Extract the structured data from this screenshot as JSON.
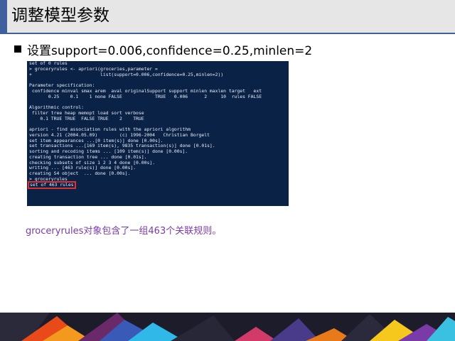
{
  "slide": {
    "title": "调整模型参数",
    "bullet": "设置support=0.006,confidence=0.25,minlen=2",
    "caption": "groceryrules对象包含了一组463个关联规则。"
  },
  "console": {
    "lines": [
      "set of 0 rules",
      "> groceryrules <- apriori(groceries,parameter =",
      "+                         list(support=0.006,confidence=0.25,minlen=2))",
      "",
      "Parameter specification:",
      " confidence minval smax arem  aval originalSupport support minlen maxlen target   ext",
      "       0.25    0.1    1 none FALSE            TRUE   0.006      2     10  rules FALSE",
      "",
      "Algorithmic control:",
      " filter tree heap memopt load sort verbose",
      "    0.1 TRUE TRUE  FALSE TRUE    2    TRUE",
      "",
      "apriori - find association rules with the apriori algorithm",
      "version 4.21 (2004.05.09)        (c) 1996-2004   Christian Borgelt",
      "set item appearances ...[0 item(s)] done [0.00s].",
      "set transactions ...[169 item(s), 9835 transaction(s)] done [0.01s].",
      "sorting and recoding items ... [109 item(s)] done [0.00s].",
      "creating transaction tree ... done [0.01s].",
      "checking subsets of size 1 2 3 4 done [0.00s].",
      "writing ... [463 rule(s)] done [0.00s].",
      "creating S4 object  ... done [0.00s].",
      "> groceryrules"
    ],
    "highlighted_line": "set of 463 rules"
  },
  "colors": {
    "accent": "#3f5f9f",
    "console_bg": "#0b2247",
    "console_text": "#e8eef8",
    "highlight_box": "#e03030",
    "caption": "#7a3aa8"
  }
}
